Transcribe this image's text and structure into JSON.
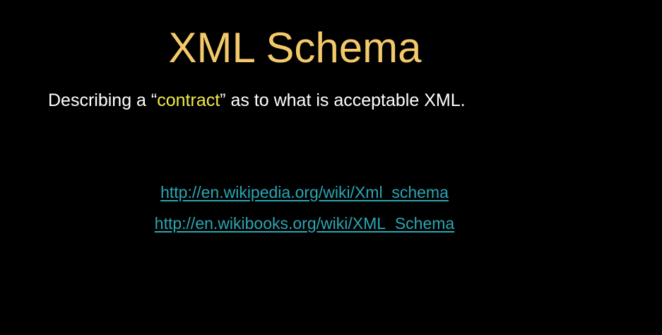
{
  "slide": {
    "title": "XML Schema",
    "subtitle": {
      "prefix": "Describing a “",
      "highlight": "contract",
      "suffix": "” as to what is acceptable XML."
    },
    "links": [
      "http://en.wikipedia.org/wiki/Xml_schema",
      "http://en.wikibooks.org/wiki/XML_Schema"
    ]
  },
  "colors": {
    "background": "#000000",
    "title": "#f4c96a",
    "text": "#ffffff",
    "highlight": "#f2ea4a",
    "link": "#2aa6b4"
  }
}
